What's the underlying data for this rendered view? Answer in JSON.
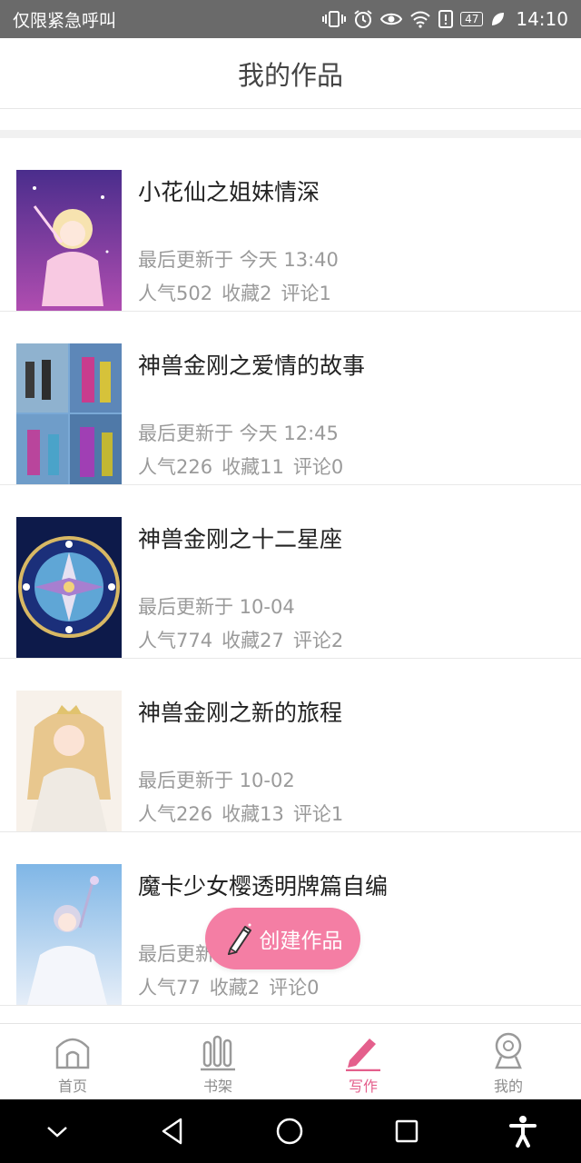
{
  "status_bar": {
    "left_text": "仅限紧急呼叫",
    "battery": "47",
    "time": "14:10"
  },
  "header": {
    "title": "我的作品"
  },
  "works": [
    {
      "title": "小花仙之姐妹情深",
      "updated": "最后更新于 今天 13:40",
      "popularity": "人气502",
      "favorites": "收藏2",
      "comments": "评论1"
    },
    {
      "title": "神兽金刚之爱情的故事",
      "updated": "最后更新于 今天 12:45",
      "popularity": "人气226",
      "favorites": "收藏11",
      "comments": "评论0"
    },
    {
      "title": "神兽金刚之十二星座",
      "updated": "最后更新于 10-04",
      "popularity": "人气774",
      "favorites": "收藏27",
      "comments": "评论2"
    },
    {
      "title": "神兽金刚之新的旅程",
      "updated": "最后更新于 10-02",
      "popularity": "人气226",
      "favorites": "收藏13",
      "comments": "评论1"
    },
    {
      "title": "魔卡少女樱透明牌篇自编",
      "updated": "最后更新于",
      "popularity": "人气77",
      "favorites": "收藏2",
      "comments": "评论0"
    }
  ],
  "fab": {
    "label": "创建作品"
  },
  "tabs": [
    {
      "label": "首页",
      "icon": "home-icon"
    },
    {
      "label": "书架",
      "icon": "bookshelf-icon"
    },
    {
      "label": "写作",
      "icon": "pencil-icon"
    },
    {
      "label": "我的",
      "icon": "profile-icon"
    }
  ],
  "colors": {
    "accent": "#f47ea4",
    "active_tab": "#e45f8c",
    "status_bar": "#6a6a6a"
  }
}
